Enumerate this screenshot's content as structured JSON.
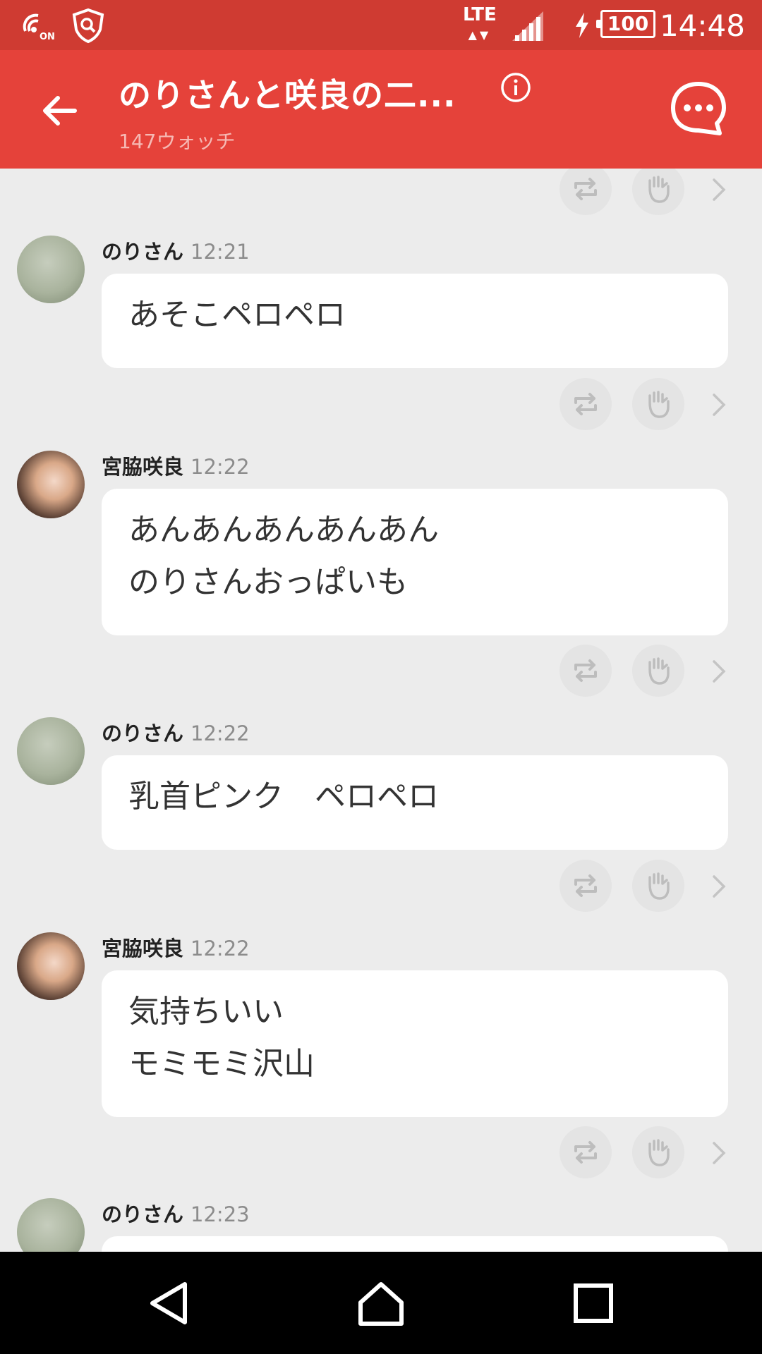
{
  "status_bar": {
    "clock": "14:48",
    "battery": "100",
    "network": "LTE",
    "icons": [
      "nfc-on-icon",
      "security-shield-icon",
      "lte-icon",
      "signal-icon",
      "charging-icon",
      "battery-icon"
    ],
    "nfc_label": "ON"
  },
  "app_bar": {
    "title": "のりさんと咲良の二...",
    "subtitle": "147ウォッチ",
    "icons": [
      "back-arrow-icon",
      "info-icon",
      "comment-icon"
    ]
  },
  "messages": [
    {
      "sender": "のりさん",
      "time": "12:21",
      "lines": [
        "あそこペロペロ"
      ]
    },
    {
      "sender": "宮脇咲良",
      "time": "12:22",
      "lines": [
        "あんあんあんあんあん",
        "のりさんおっぱいも"
      ]
    },
    {
      "sender": "のりさん",
      "time": "12:22",
      "lines": [
        "乳首ピンク　ペロペロ"
      ]
    },
    {
      "sender": "宮脇咲良",
      "time": "12:22",
      "lines": [
        "気持ちいい",
        "モミモミ沢山"
      ]
    },
    {
      "sender": "のりさん",
      "time": "12:23",
      "lines": []
    }
  ],
  "action_icons": [
    "retweet-icon",
    "clap-icon",
    "chevron-right-icon"
  ],
  "nav_bar": {
    "icons": [
      "nav-back-icon",
      "nav-home-icon",
      "nav-recents-icon"
    ]
  },
  "colors": {
    "status_bar": "#cf3b32",
    "app_bar": "#e5423a",
    "background": "#ececec",
    "bubble": "#ffffff"
  }
}
